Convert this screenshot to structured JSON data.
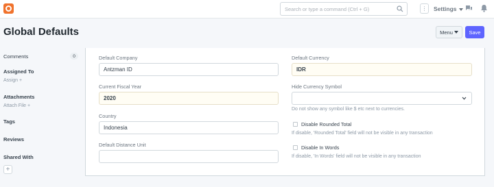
{
  "navbar": {
    "search_placeholder": "Search or type a command (Ctrl + G)",
    "more_icon": "⋮",
    "settings_label": "Settings"
  },
  "page": {
    "title": "Global Defaults",
    "menu_label": "Menu",
    "save_label": "Save"
  },
  "sidebar": {
    "comments_label": "Comments",
    "comments_count": "0",
    "assigned_to_label": "Assigned To",
    "assign_link": "Assign +",
    "attachments_label": "Attachments",
    "attach_file_link": "Attach File +",
    "tags_label": "Tags",
    "reviews_label": "Reviews",
    "shared_with_label": "Shared With",
    "add_symbol": "+"
  },
  "form": {
    "default_company": {
      "label": "Default Company",
      "value": "Antzman ID"
    },
    "current_fiscal_year": {
      "label": "Current Fiscal Year",
      "value": "2020"
    },
    "country": {
      "label": "Country",
      "value": "Indonesia"
    },
    "default_distance_unit": {
      "label": "Default Distance Unit",
      "value": ""
    },
    "default_currency": {
      "label": "Default Currency",
      "value": "IDR"
    },
    "hide_currency_symbol": {
      "label": "Hide Currency Symbol",
      "value": "",
      "help": "Do not show any symbol like $ etc next to currencies."
    },
    "disable_rounded_total": {
      "label": "Disable Rounded Total",
      "checked": false,
      "help": "If disable, 'Rounded Total' field will not be visible in any transaction"
    },
    "disable_in_words": {
      "label": "Disable In Words",
      "checked": false,
      "help": "If disable, 'In Words' field will not be visible in any transaction"
    }
  },
  "colors": {
    "brand": "#f0722c",
    "primary": "#5e64ff",
    "filled_field": "#fffdf4"
  }
}
